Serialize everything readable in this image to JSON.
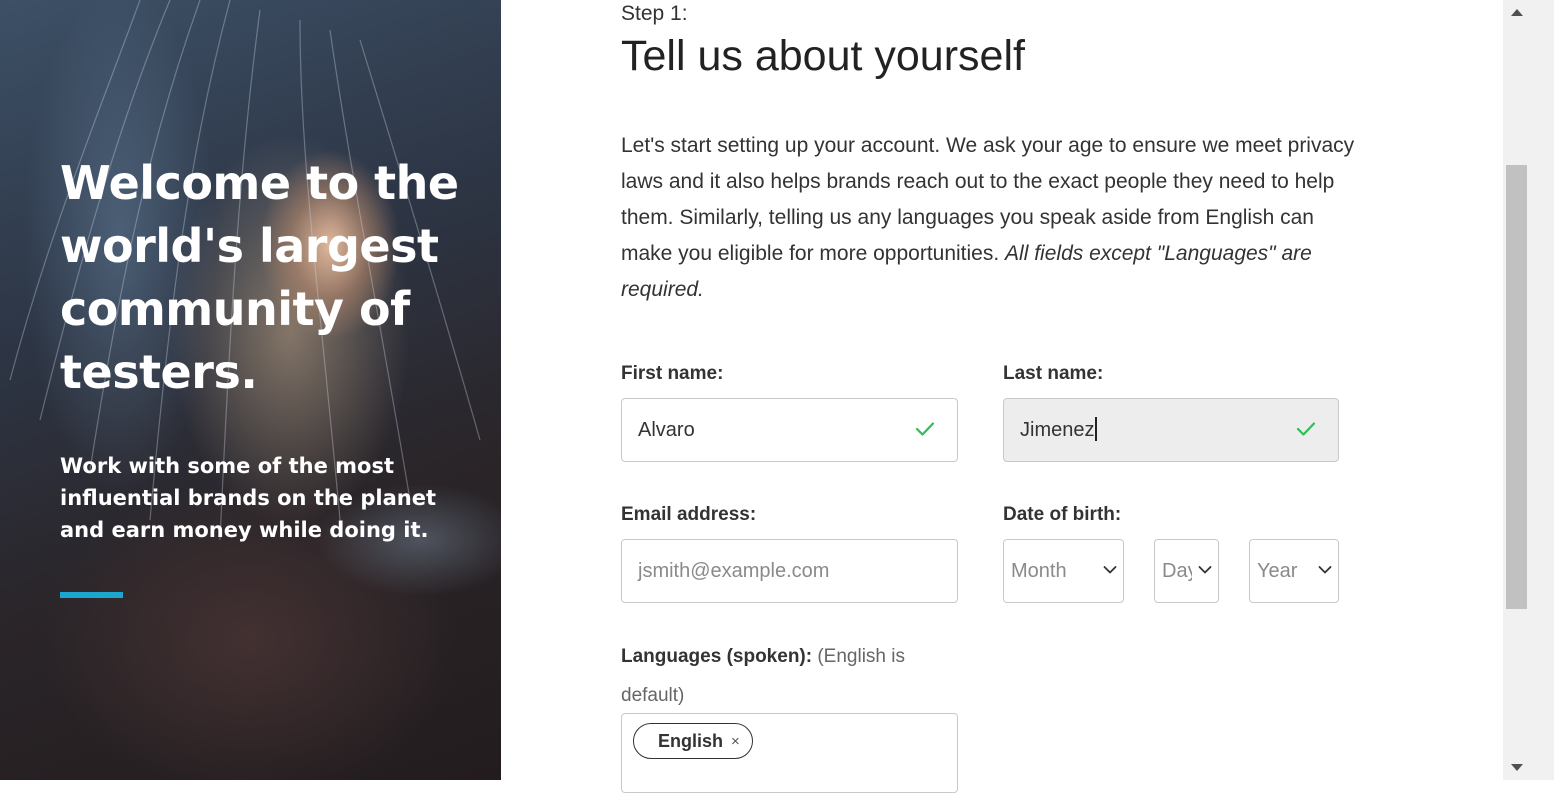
{
  "hero": {
    "title": "Welcome to the world's largest community of testers.",
    "subtitle": "Work with some of the most influential brands on the planet and earn money while doing it.",
    "accent_color": "#1aa6cf"
  },
  "step": {
    "label": "Step 1:",
    "title": "Tell us about yourself",
    "intro": "Let's start setting up your account. We ask your age to ensure we meet privacy laws and it also helps brands reach out to the exact people they need to help them. Similarly, telling us any languages you speak aside from English can make you eligible for more opportunities.",
    "intro_note": "All fields except \"Languages\" are required."
  },
  "form": {
    "first_name": {
      "label": "First name:",
      "value": "Alvaro",
      "valid_icon": "check-icon"
    },
    "last_name": {
      "label": "Last name:",
      "value": "Jimenez",
      "valid_icon": "check-icon"
    },
    "email": {
      "label": "Email address:",
      "placeholder": "jsmith@example.com"
    },
    "dob": {
      "label": "Date of birth:",
      "month": "Month",
      "day": "Day",
      "year": "Year"
    },
    "languages": {
      "label": "Languages (spoken):",
      "hint": "(English is default)",
      "selected": [
        {
          "label": "English",
          "remove": "×"
        }
      ]
    }
  },
  "colors": {
    "valid": "#2ebd59",
    "border": "#c9c9c9"
  }
}
